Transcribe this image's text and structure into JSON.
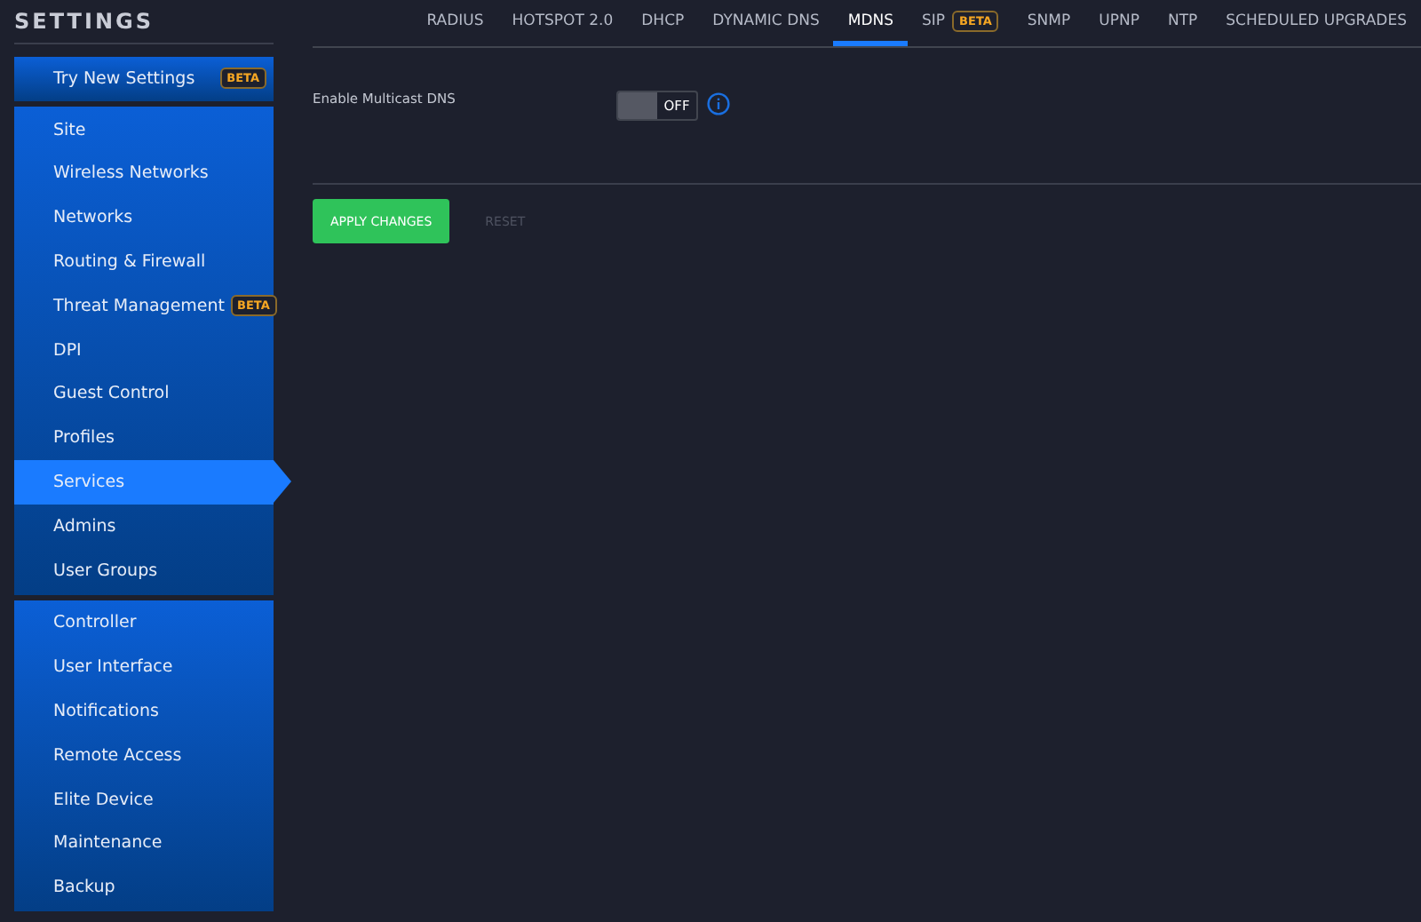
{
  "sidebar": {
    "title": "SETTINGS",
    "groups": [
      {
        "items": [
          {
            "label": "Try New Settings",
            "selected": false,
            "badge": "BETA"
          }
        ]
      },
      {
        "items": [
          {
            "label": "Site",
            "selected": false
          },
          {
            "label": "Wireless Networks",
            "selected": false
          },
          {
            "label": "Networks",
            "selected": false
          },
          {
            "label": "Routing & Firewall",
            "selected": false
          },
          {
            "label": "Threat Management",
            "selected": false,
            "badge": "BETA"
          },
          {
            "label": "DPI",
            "selected": false
          },
          {
            "label": "Guest Control",
            "selected": false
          },
          {
            "label": "Profiles",
            "selected": false
          },
          {
            "label": "Services",
            "selected": true
          },
          {
            "label": "Admins",
            "selected": false
          },
          {
            "label": "User Groups",
            "selected": false
          }
        ]
      },
      {
        "items": [
          {
            "label": "Controller",
            "selected": false
          },
          {
            "label": "User Interface",
            "selected": false
          },
          {
            "label": "Notifications",
            "selected": false
          },
          {
            "label": "Remote Access",
            "selected": false
          },
          {
            "label": "Elite Device",
            "selected": false
          },
          {
            "label": "Maintenance",
            "selected": false
          },
          {
            "label": "Backup",
            "selected": false
          }
        ]
      }
    ]
  },
  "tabs": [
    {
      "label": "RADIUS",
      "selected": false
    },
    {
      "label": "HOTSPOT 2.0",
      "selected": false
    },
    {
      "label": "DHCP",
      "selected": false
    },
    {
      "label": "DYNAMIC DNS",
      "selected": false
    },
    {
      "label": "MDNS",
      "selected": true
    },
    {
      "label": "SIP",
      "selected": false,
      "badge": "BETA"
    },
    {
      "label": "SNMP",
      "selected": false
    },
    {
      "label": "UPNP",
      "selected": false
    },
    {
      "label": "NTP",
      "selected": false
    },
    {
      "label": "SCHEDULED UPGRADES",
      "selected": false
    }
  ],
  "setting": {
    "label": "Enable Multicast DNS",
    "on": false,
    "state_text": "OFF"
  },
  "buttons": {
    "apply": "APPLY CHANGES",
    "reset": "RESET"
  }
}
